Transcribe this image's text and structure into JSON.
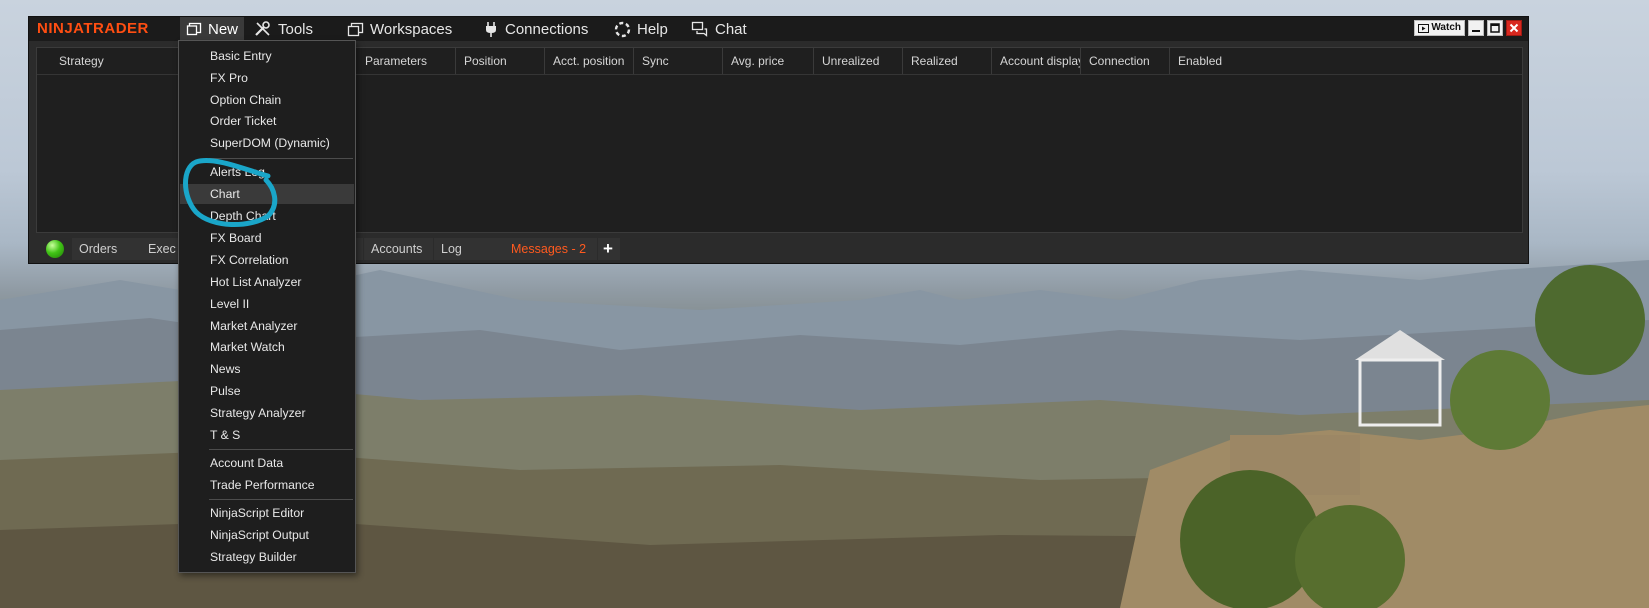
{
  "app": {
    "logo": "NINJATRADER",
    "accent_color": "#ff4e12"
  },
  "menubar": {
    "items": [
      {
        "label": "New",
        "icon": "new-window-icon"
      },
      {
        "label": "Tools",
        "icon": "tools-icon"
      },
      {
        "label": "Workspaces",
        "icon": "workspaces-icon"
      },
      {
        "label": "Connections",
        "icon": "plug-icon"
      },
      {
        "label": "Help",
        "icon": "lifebuoy-icon"
      },
      {
        "label": "Chat",
        "icon": "chat-icon"
      }
    ]
  },
  "window_controls": {
    "watch_label": "Watch"
  },
  "grid": {
    "columns": [
      "Strategy",
      "Parameters",
      "Position",
      "Acct. position",
      "Sync",
      "Avg. price",
      "Unrealized",
      "Realized",
      "Account display",
      "Connection",
      "Enabled"
    ]
  },
  "tabs": {
    "items": [
      "Orders",
      "Exec",
      "ns",
      "Accounts",
      "Log",
      "Messages - 2",
      "+"
    ],
    "messages_color": "#ff5a1f"
  },
  "new_menu": {
    "groups": [
      [
        "Basic Entry",
        "FX Pro",
        "Option Chain",
        "Order Ticket",
        "SuperDOM (Dynamic)"
      ],
      [
        "Alerts Log",
        "Chart",
        "Depth Chart",
        "FX Board",
        "FX Correlation",
        "Hot List Analyzer",
        "Level II",
        "Market Analyzer",
        "Market Watch",
        "News",
        "Pulse",
        "Strategy Analyzer",
        "T & S"
      ],
      [
        "Account Data",
        "Trade Performance"
      ],
      [
        "NinjaScript Editor",
        "NinjaScript Output",
        "Strategy Builder"
      ]
    ],
    "highlighted": "Chart"
  },
  "annotation_color": "#1aa6c9"
}
